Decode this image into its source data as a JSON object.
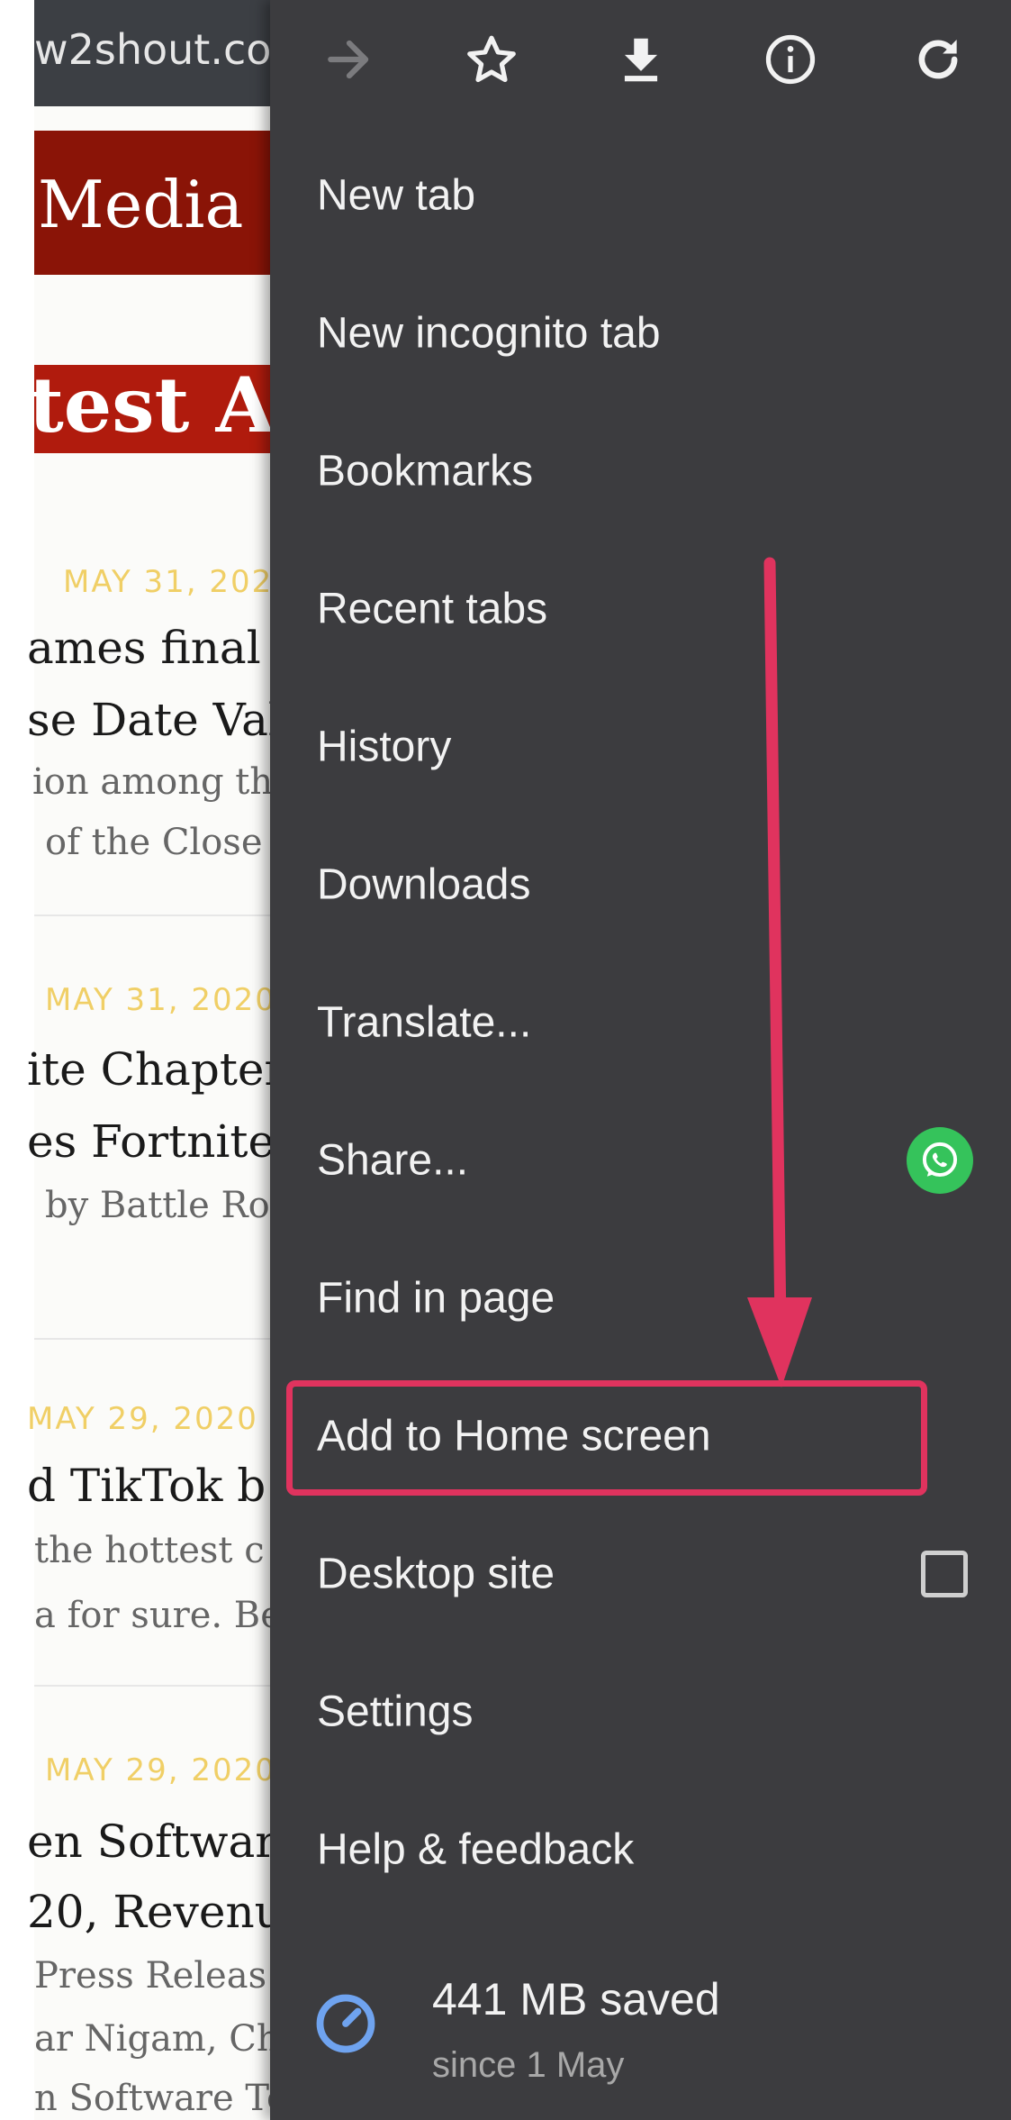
{
  "background_page": {
    "url_text": "w2shout.co",
    "brand": "Media",
    "section_heading": "test Ar",
    "articles": [
      {
        "date": "MAY 31, 202",
        "lines": [
          "ames final",
          "se Date Val",
          "ion among th",
          "of the Close"
        ]
      },
      {
        "date": "MAY 31, 2020",
        "lines": [
          "ite Chapter",
          "es Fortnite",
          "by Battle Ro"
        ]
      },
      {
        "date": "MAY 29, 2020",
        "lines": [
          "d TikTok b",
          "the hottest c",
          "a for sure. Be"
        ]
      },
      {
        "date": "MAY 29, 2020",
        "lines": [
          "en Softwar",
          "20, Revenu",
          "Press Releas",
          "ar Nigam, Ch",
          "n Software Technologies Ltd. said"
        ]
      }
    ]
  },
  "menu": {
    "toolbar": [
      {
        "name": "forward-icon",
        "enabled": false
      },
      {
        "name": "star-icon",
        "enabled": true
      },
      {
        "name": "download-icon",
        "enabled": true
      },
      {
        "name": "info-icon",
        "enabled": true
      },
      {
        "name": "reload-icon",
        "enabled": true
      }
    ],
    "items": [
      {
        "label": "New tab"
      },
      {
        "label": "New incognito tab"
      },
      {
        "label": "Bookmarks"
      },
      {
        "label": "Recent tabs"
      },
      {
        "label": "History"
      },
      {
        "label": "Downloads"
      },
      {
        "label": "Translate..."
      },
      {
        "label": "Share...",
        "trailing_icon": "whatsapp-icon"
      },
      {
        "label": "Find in page"
      },
      {
        "label": "Add to Home screen",
        "highlighted": true
      },
      {
        "label": "Desktop site",
        "checkbox": false
      },
      {
        "label": "Settings"
      },
      {
        "label": "Help & feedback"
      }
    ],
    "savings": {
      "icon": "data-saver-gauge-icon",
      "main": "441 MB saved",
      "sub": "since 1 May"
    }
  },
  "annotation": {
    "color": "#e0335e",
    "arrow": "points-down-to-add-to-home-screen"
  },
  "colors": {
    "menu_bg": "#3c3c3f",
    "menu_text": "#f2f2f2",
    "highlight": "#e0335e",
    "whatsapp": "#35c35b",
    "brand_red": "#8a1407",
    "date_gold": "#f0cf66"
  }
}
